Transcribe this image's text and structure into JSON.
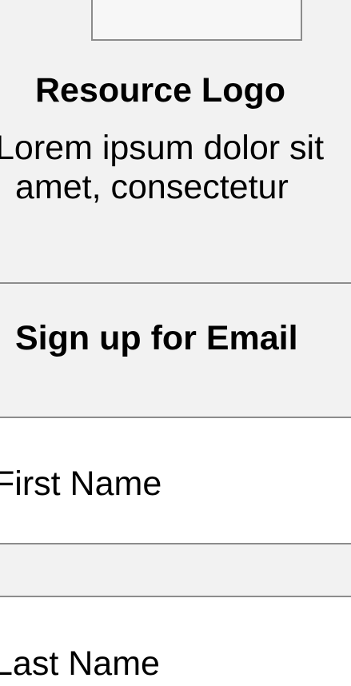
{
  "resource": {
    "logo_title": "Resource Logo",
    "description_line1": "Lorem ipsum dolor sit",
    "description_line2": "amet, consectetur"
  },
  "signup": {
    "title": "Sign up for Email"
  },
  "form": {
    "first_name_placeholder": "First Name",
    "last_name_placeholder": "Last Name"
  }
}
